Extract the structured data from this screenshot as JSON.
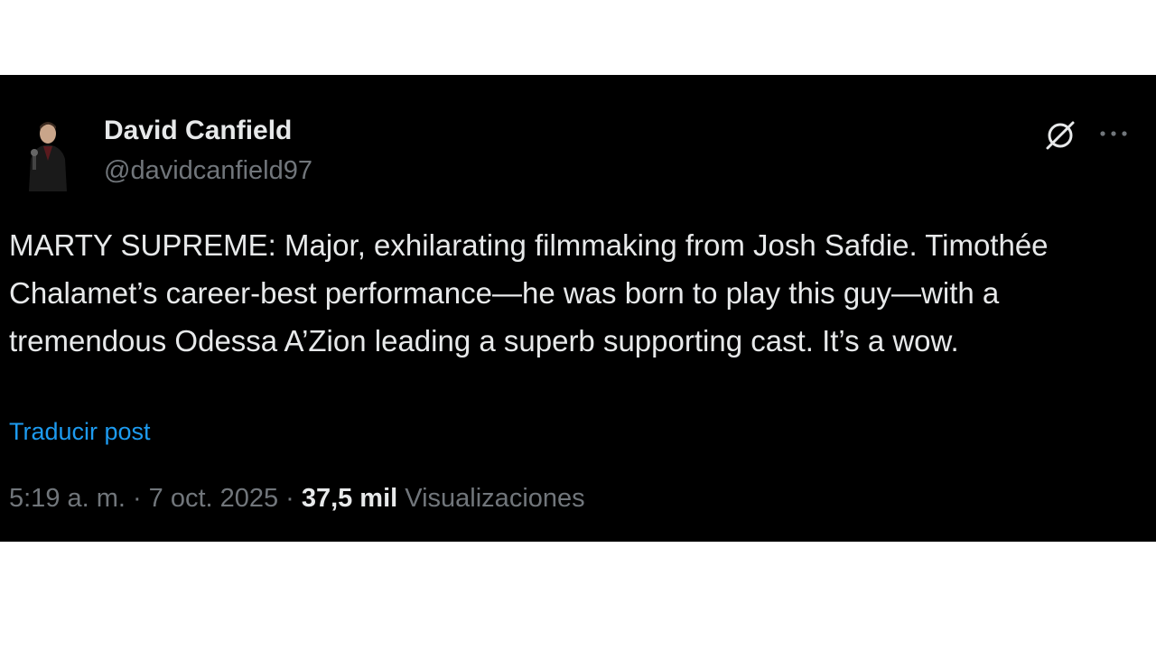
{
  "author": {
    "name": "David Canfield",
    "handle": "@davidcanfield97"
  },
  "tweet": {
    "text": "MARTY SUPREME: Major, exhilarating filmmaking from Josh Safdie. Timothée Chalamet’s career-best performance—he was born to play this guy—with a tremendous Odessa A’Zion leading a superb supporting cast. It’s a wow.",
    "translate_label": "Traducir post"
  },
  "meta": {
    "time": "5:19 a. m.",
    "separator": "·",
    "date": "7 oct. 2025",
    "views_count": "37,5 mil",
    "views_label": "Visualizaciones"
  },
  "icons": {
    "action_1": "grok-icon",
    "action_2": "more-options-icon"
  },
  "colors": {
    "background": "#000000",
    "text_primary": "#e7e9ea",
    "text_secondary": "#71767b",
    "link": "#1d9bf0"
  }
}
